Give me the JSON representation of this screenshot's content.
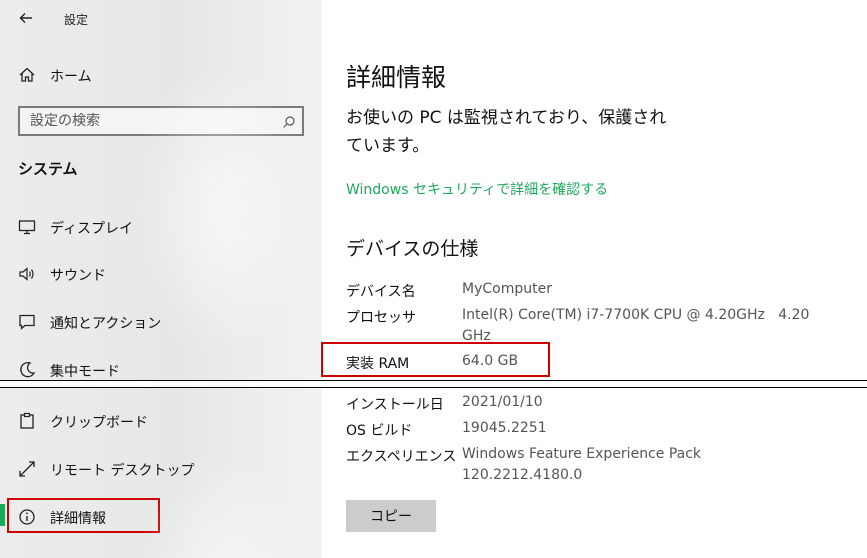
{
  "window": {
    "title": "設定",
    "back_icon": "back-arrow-icon"
  },
  "sidebar": {
    "home_label": "ホーム",
    "search_placeholder": "設定の検索",
    "section_title": "システム",
    "items_top": [
      {
        "label": "ディスプレイ",
        "icon": "monitor-icon"
      },
      {
        "label": "サウンド",
        "icon": "speaker-icon"
      },
      {
        "label": "通知とアクション",
        "icon": "notification-icon"
      },
      {
        "label": "集中モード",
        "icon": "moon-icon"
      }
    ],
    "items_bottom": [
      {
        "label": "クリップボード",
        "icon": "clipboard-icon"
      },
      {
        "label": "リモート デスクトップ",
        "icon": "remote-desktop-icon"
      },
      {
        "label": "詳細情報",
        "icon": "info-icon",
        "selected": true
      }
    ],
    "accent_color": "#1ea85a"
  },
  "main": {
    "title": "詳細情報",
    "protection_line1": "お使いの PC は監視されており、保護され",
    "protection_line2": "ています。",
    "security_link": "Windows セキュリティで詳細を確認する",
    "specs_title": "デバイスの仕様",
    "specs": {
      "device_name": {
        "label": "デバイス名",
        "value": "MyComputer"
      },
      "processor": {
        "label": "プロセッサ",
        "value_line1": "Intel(R) Core(TM) i7-7700K CPU @ 4.20GHz   4.20",
        "value_line2": "GHz"
      },
      "ram": {
        "label": "実装 RAM",
        "value": "64.0 GB"
      }
    },
    "windows_specs": {
      "install_date": {
        "label": "インストール日",
        "value": "2021/01/10"
      },
      "os_build": {
        "label": "OS ビルド",
        "value": "19045.2251"
      },
      "experience": {
        "label": "エクスペリエンス",
        "value_line1": "Windows Feature Experience Pack",
        "value_line2": "120.2212.4180.0"
      }
    },
    "copy_button": "コピー"
  },
  "highlight_color": "#cc0000"
}
